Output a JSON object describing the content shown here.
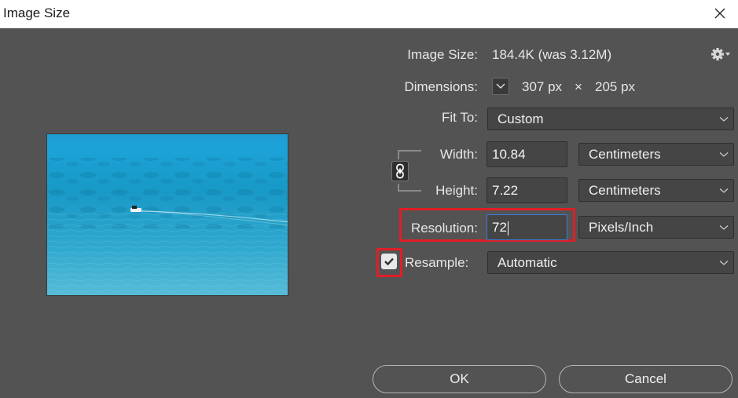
{
  "window": {
    "title": "Image Size"
  },
  "info": {
    "image_size_label": "Image Size:",
    "image_size_value": "184.4K (was 3.12M)",
    "dimensions_label": "Dimensions:",
    "dimensions_width": "307 px",
    "dimensions_sep": "×",
    "dimensions_height": "205 px"
  },
  "fit_to": {
    "label": "Fit To:",
    "value": "Custom"
  },
  "width": {
    "label": "Width:",
    "value": "10.84",
    "unit": "Centimeters"
  },
  "height": {
    "label": "Height:",
    "value": "7.22",
    "unit": "Centimeters"
  },
  "resolution": {
    "label": "Resolution:",
    "value": "72",
    "unit": "Pixels/Inch"
  },
  "resample": {
    "label": "Resample:",
    "checked": true,
    "value": "Automatic"
  },
  "buttons": {
    "ok": "OK",
    "cancel": "Cancel"
  },
  "icons": {
    "close": "close-icon",
    "gear": "gear-icon",
    "dimensions_toggle": "chevron-down-icon",
    "link": "chain-link-icon",
    "checkbox": "checkmark-icon"
  },
  "colors": {
    "dialog_bg": "#535353",
    "highlight": "#e01e27",
    "field_bg": "#454545",
    "text": "#e6e6e6"
  }
}
